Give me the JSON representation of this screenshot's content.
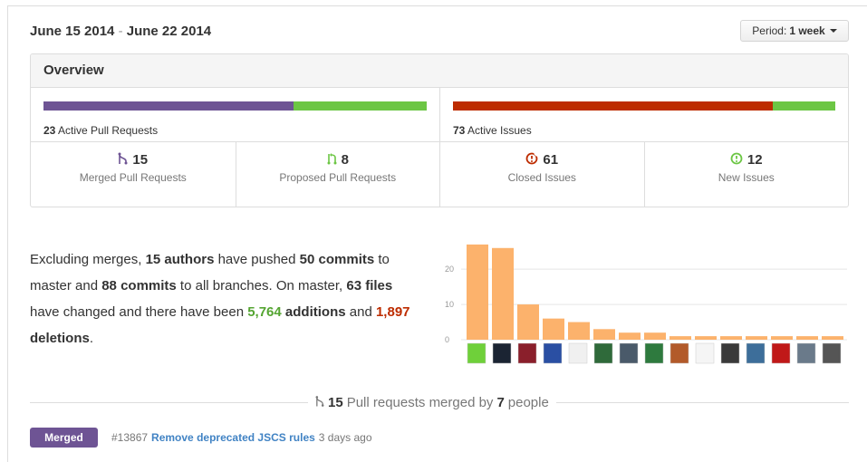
{
  "header": {
    "date_start": "June 15 2014",
    "date_sep": " - ",
    "date_end": "June 22 2014",
    "period_label": "Period:",
    "period_value": "1 week"
  },
  "overview": {
    "title": "Overview",
    "pull_requests": {
      "count": "23",
      "label": "Active Pull Requests",
      "merged_fraction": 0.652,
      "colors": {
        "merged": "#6e5494",
        "open": "#6cc644"
      }
    },
    "issues": {
      "count": "73",
      "label": "Active Issues",
      "closed_fraction": 0.836,
      "colors": {
        "closed": "#bd2c00",
        "new": "#6cc644"
      }
    },
    "stats": [
      {
        "value": "15",
        "label": "Merged Pull Requests",
        "icon": "git-merge-icon",
        "color": "#6e5494"
      },
      {
        "value": "8",
        "label": "Proposed Pull Requests",
        "icon": "git-pull-request-icon",
        "color": "#6cc644"
      },
      {
        "value": "61",
        "label": "Closed Issues",
        "icon": "issue-closed-icon",
        "color": "#bd2c00"
      },
      {
        "value": "12",
        "label": "New Issues",
        "icon": "issue-opened-icon",
        "color": "#6cc644"
      }
    ]
  },
  "summary": {
    "p1": "Excluding merges, ",
    "authors": "15 authors",
    "p2": " have pushed ",
    "commits_master": "50 commits",
    "p3": " to master and ",
    "commits_all": "88 commits",
    "p4": " to all branches. On master, ",
    "files": "63 files",
    "p5": " have changed and there have been ",
    "additions_num": "5,764",
    "additions_word": " additions",
    "p6": " and ",
    "deletions_num": "1,897",
    "deletions_word": " deletions",
    "p7": "."
  },
  "chart_data": {
    "type": "bar",
    "categories": [
      "author-1",
      "author-2",
      "author-3",
      "author-4",
      "author-5",
      "author-6",
      "author-7",
      "author-8",
      "author-9",
      "author-10",
      "author-11",
      "author-12",
      "author-13",
      "author-14",
      "author-15"
    ],
    "values": [
      27,
      26,
      10,
      6,
      5,
      3,
      2,
      2,
      1,
      1,
      1,
      1,
      1,
      1,
      1
    ],
    "yticks": [
      "0",
      "10",
      "20"
    ],
    "ylim": [
      0,
      28
    ],
    "bar_color": "#fcb26c",
    "avatar_colors": [
      "#6fd03a",
      "#1b2433",
      "#8a1f2b",
      "#2a4fa3",
      "#f0f0f0",
      "#2f6a3a",
      "#4a5a6a",
      "#2e7a3e",
      "#b25a2a",
      "#f5f5f5",
      "#3a3a3a",
      "#3d6e9a",
      "#c01818",
      "#6a7a8a",
      "#555555"
    ]
  },
  "merged_section": {
    "count": "15",
    "text1": " Pull requests merged by ",
    "people": "7",
    "text2": " people"
  },
  "pr": {
    "badge": "Merged",
    "number": "#13867",
    "title": "Remove deprecated JSCS rules",
    "time": "3 days ago"
  }
}
